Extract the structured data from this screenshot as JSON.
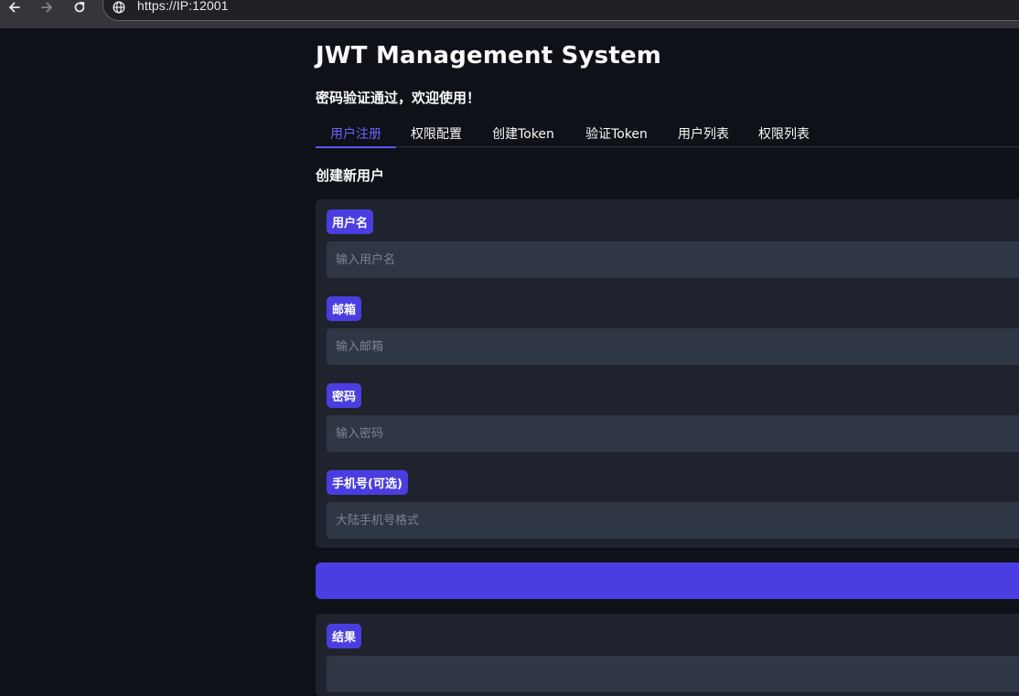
{
  "browser": {
    "url": "https://IP:12001"
  },
  "app": {
    "title": "JWT Management System",
    "status_message": "密码验证通过，欢迎使用！"
  },
  "tabs": [
    {
      "label": "用户注册",
      "active": true
    },
    {
      "label": "权限配置",
      "active": false
    },
    {
      "label": "创建Token",
      "active": false
    },
    {
      "label": "验证Token",
      "active": false
    },
    {
      "label": "用户列表",
      "active": false
    },
    {
      "label": "权限列表",
      "active": false
    }
  ],
  "form": {
    "section_title": "创建新用户",
    "fields": [
      {
        "label": "用户名",
        "placeholder": "输入用户名",
        "value": ""
      },
      {
        "label": "邮箱",
        "placeholder": "输入邮箱",
        "value": ""
      },
      {
        "label": "密码",
        "placeholder": "输入密码",
        "value": ""
      },
      {
        "label": "手机号(可选)",
        "placeholder": "大陆手机号格式",
        "value": ""
      }
    ],
    "submit_label": ""
  },
  "result": {
    "label": "结果",
    "value": ""
  },
  "colors": {
    "accent": "#4a3ee0",
    "active_tab": "#6c63ff",
    "background": "#0e1117",
    "card": "#1f232d",
    "input": "#2f3644"
  },
  "icons": {
    "back": "arrow-left-icon",
    "forward": "arrow-right-icon",
    "reload": "reload-icon",
    "site_info": "globe-icon"
  }
}
